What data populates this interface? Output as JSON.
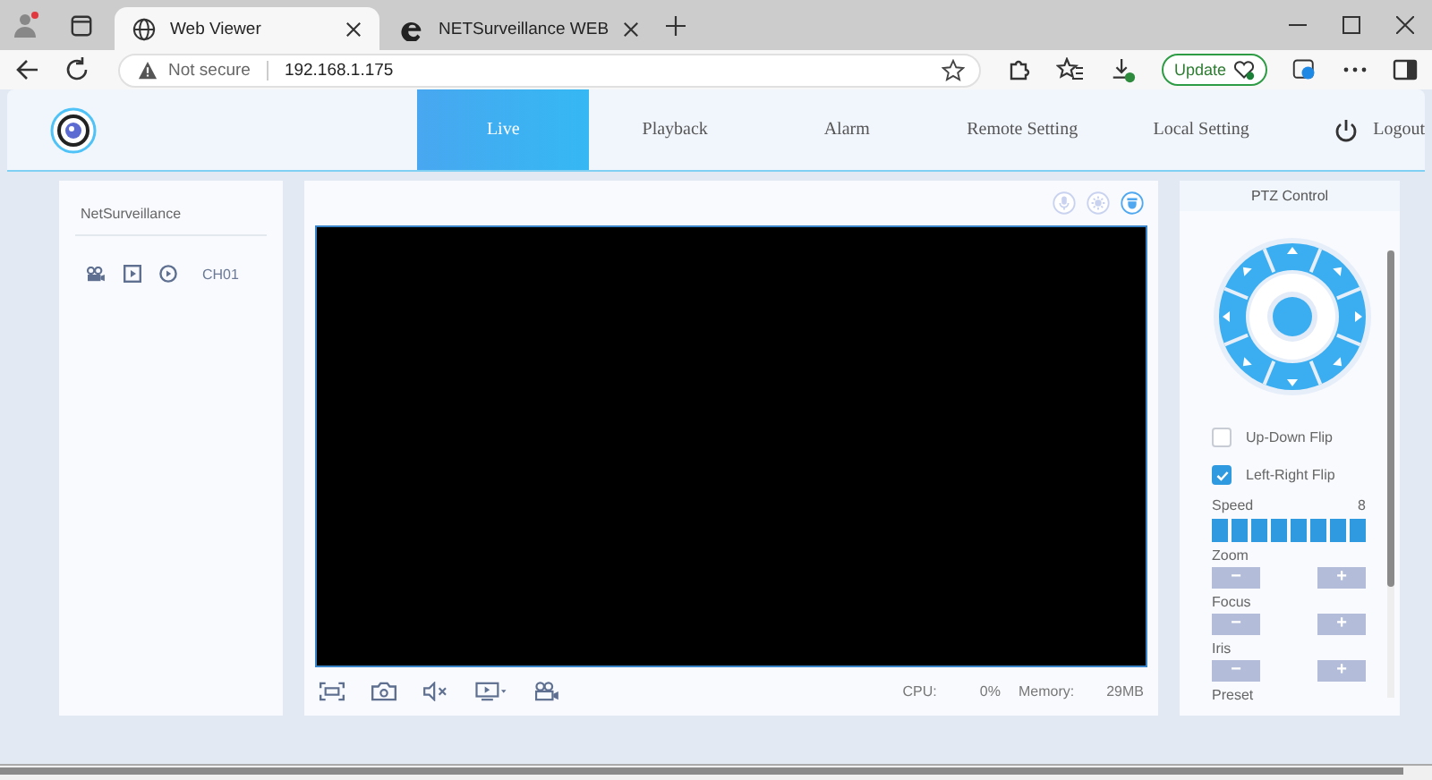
{
  "browser": {
    "tabs": [
      {
        "title": "Web Viewer",
        "selected": true
      },
      {
        "title": "NETSurveillance WEB",
        "selected": false
      }
    ],
    "security": "Not secure",
    "url": "192.168.1.175",
    "update": "Update"
  },
  "nav": {
    "items": [
      {
        "label": "Live",
        "selected": true
      },
      {
        "label": "Playback",
        "selected": false
      },
      {
        "label": "Alarm",
        "selected": false
      },
      {
        "label": "Remote Setting",
        "selected": false
      },
      {
        "label": "Local Setting",
        "selected": false
      }
    ],
    "logout": "Logout"
  },
  "sidebar": {
    "title": "NetSurveillance",
    "channels": [
      {
        "name": "CH01"
      }
    ]
  },
  "status": {
    "cpu_label": "CPU:",
    "cpu_value": "0%",
    "memory_label": "Memory:",
    "memory_value": "29MB"
  },
  "ptz": {
    "title": "PTZ Control",
    "options": [
      {
        "label": "Up-Down Flip",
        "checked": false
      },
      {
        "label": "Left-Right Flip",
        "checked": true
      }
    ],
    "speed": {
      "label": "Speed",
      "value": "8",
      "level": 1
    },
    "controls": [
      {
        "label": "Zoom",
        "minus": "−",
        "plus": "+"
      },
      {
        "label": "Focus",
        "minus": "−",
        "plus": "+"
      },
      {
        "label": "Iris",
        "minus": "−",
        "plus": "+"
      }
    ],
    "preset": "Preset"
  }
}
